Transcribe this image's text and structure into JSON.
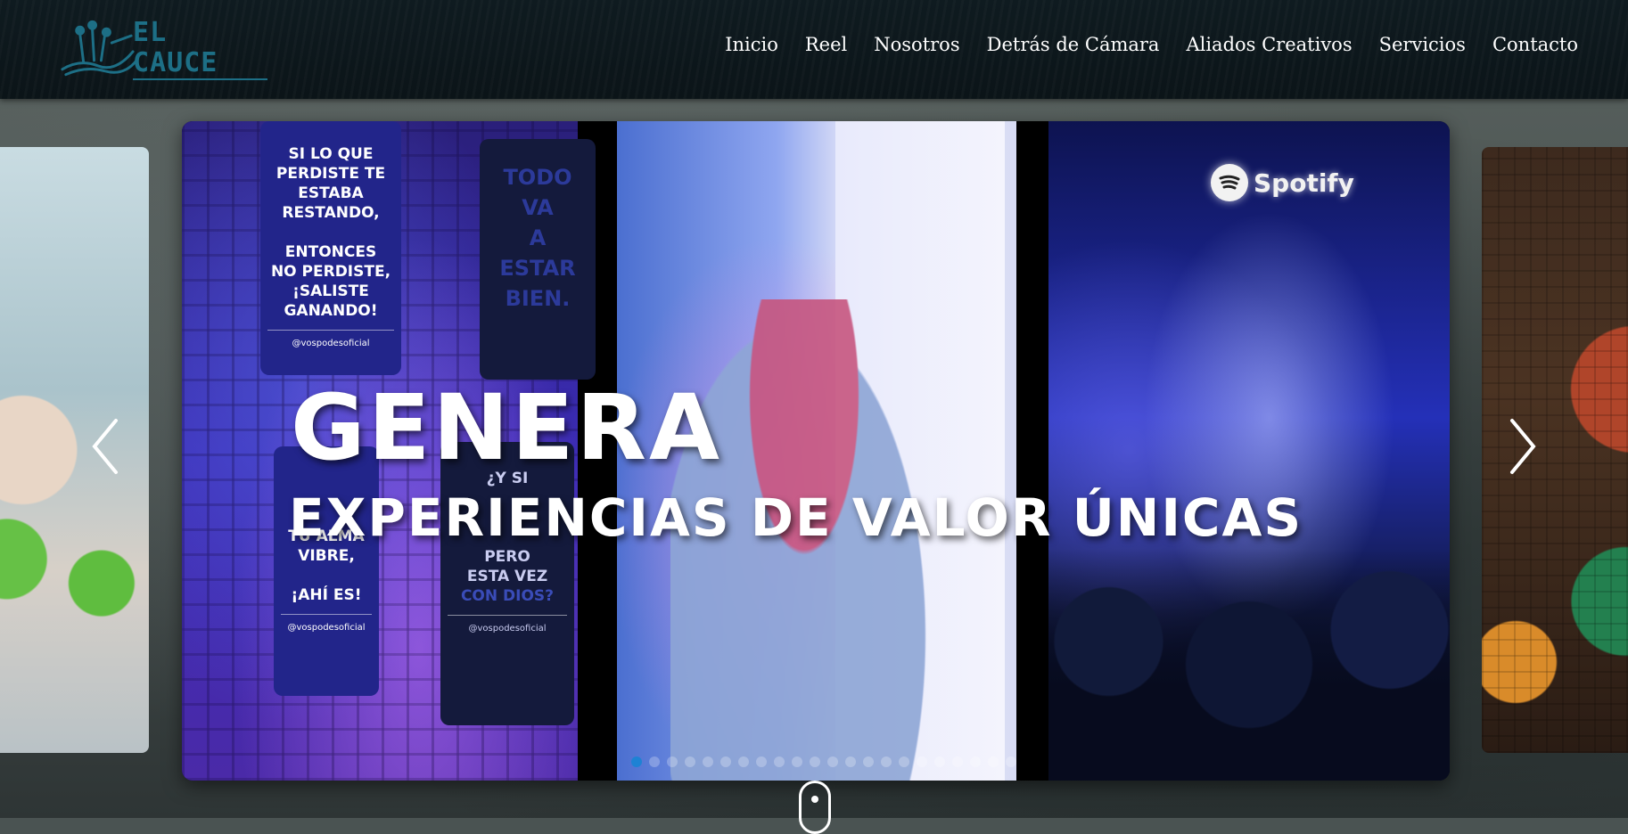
{
  "brand": {
    "name": "EL CAUCE",
    "color": "#1d6f86"
  },
  "nav": {
    "items": [
      {
        "label": "Inicio"
      },
      {
        "label": "Reel"
      },
      {
        "label": "Nosotros"
      },
      {
        "label": "Detrás de Cámara"
      },
      {
        "label": "Aliados Creativos"
      },
      {
        "label": "Servicios"
      },
      {
        "label": "Contacto"
      }
    ]
  },
  "hero": {
    "title": "GENERA",
    "subtitle": "EXPERIENCIAS DE VALOR ÚNICAS"
  },
  "slide_tags": {
    "tag1_lines": [
      "SI LO QUE",
      "PERDISTE TE",
      "ESTABA",
      "RESTANDO,",
      "",
      "ENTONCES",
      "NO PERDISTE,",
      "¡SALISTE",
      "GANANDO!"
    ],
    "tag1_handle": "@vospodesoficial",
    "tag2_lines": [
      "TODO",
      "VA",
      "A",
      "ESTAR",
      "BIEN."
    ],
    "tag3_lines": [
      "TU ALMA",
      "VIBRE,",
      "",
      "¡AHÍ ES!"
    ],
    "tag3_handle": "@vospodesoficial",
    "tag4_lines": [
      "¿Y SI",
      "",
      "PERO",
      "ESTA VEZ",
      "CON DIOS?"
    ],
    "tag4_handle": "@vospodesoficial"
  },
  "spotify_sign": "Spotify",
  "carousel": {
    "dot_count": 22,
    "active_index": 0,
    "active_color": "#1e82d4",
    "prev_icon": "chevron-left-icon",
    "next_icon": "chevron-right-icon"
  },
  "scroll_icon": "mouse-scroll-icon"
}
